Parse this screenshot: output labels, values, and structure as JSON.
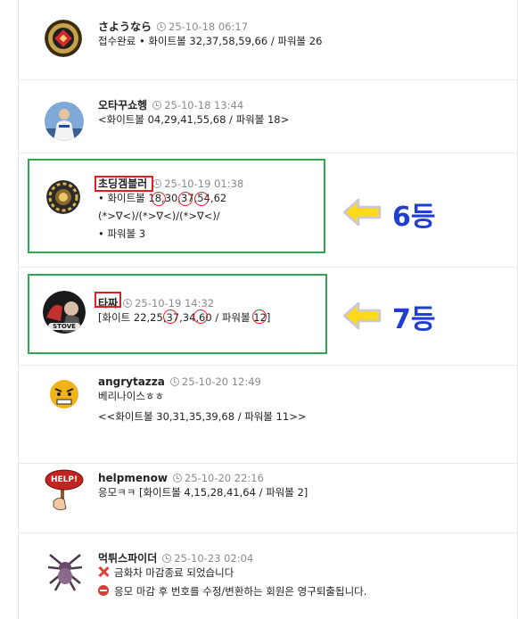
{
  "comments": [
    {
      "nick": "さようなら",
      "time": "25-10-18 06:17",
      "lines": [
        "접수완료 • 화이트볼 32,37,58,59,66 / 파워볼 26"
      ]
    },
    {
      "nick": "오타꾸쇼헹",
      "time": "25-10-18 13:44",
      "lines": [
        "<화이트볼 04,29,41,55,68 / 파워볼 18>"
      ]
    },
    {
      "nick": "초딩겜블러",
      "time": "25-10-19 01:38",
      "lines": [
        "• 화이트볼 18,30,37,54,62",
        "(*>∇<)/(*>∇<)/(*>∇<)/",
        "• 파워볼 3"
      ]
    },
    {
      "nick": "타짜",
      "time": "25-10-19 14:32",
      "lines": [
        "[화이트 22,25,37,34,60 / 파워볼 12]"
      ]
    },
    {
      "nick": "angrytazza",
      "time": "25-10-20 12:49",
      "lines": [
        "베리나이스ㅎㅎ",
        "<<화이트볼 30,31,35,39,68 / 파워볼 11>>"
      ]
    },
    {
      "nick": "helpmenow",
      "time": "25-10-20 22:16",
      "lines": [
        "응모ㅋㅋ [화이트볼 4,15,28,41,64 / 파워볼 2]"
      ]
    },
    {
      "nick": "먹튀스파이더",
      "time": "25-10-23 02:04",
      "lines": [
        "금화차 마감종료 되었습니다",
        "응모 마감 후 번호를 수정/변환하는 회원은 영구퇴출됩니다."
      ]
    }
  ],
  "annotations": {
    "rank_a": "6등",
    "rank_b": "7등",
    "avatar_badge_stove": "STOVE",
    "avatar_sign_help": "HELP!"
  },
  "colors": {
    "highlight_box": "#2fa84f",
    "mark_red": "#e02020",
    "arrow_yellow": "#ffd91a",
    "rank_blue": "#1e3fd0"
  }
}
